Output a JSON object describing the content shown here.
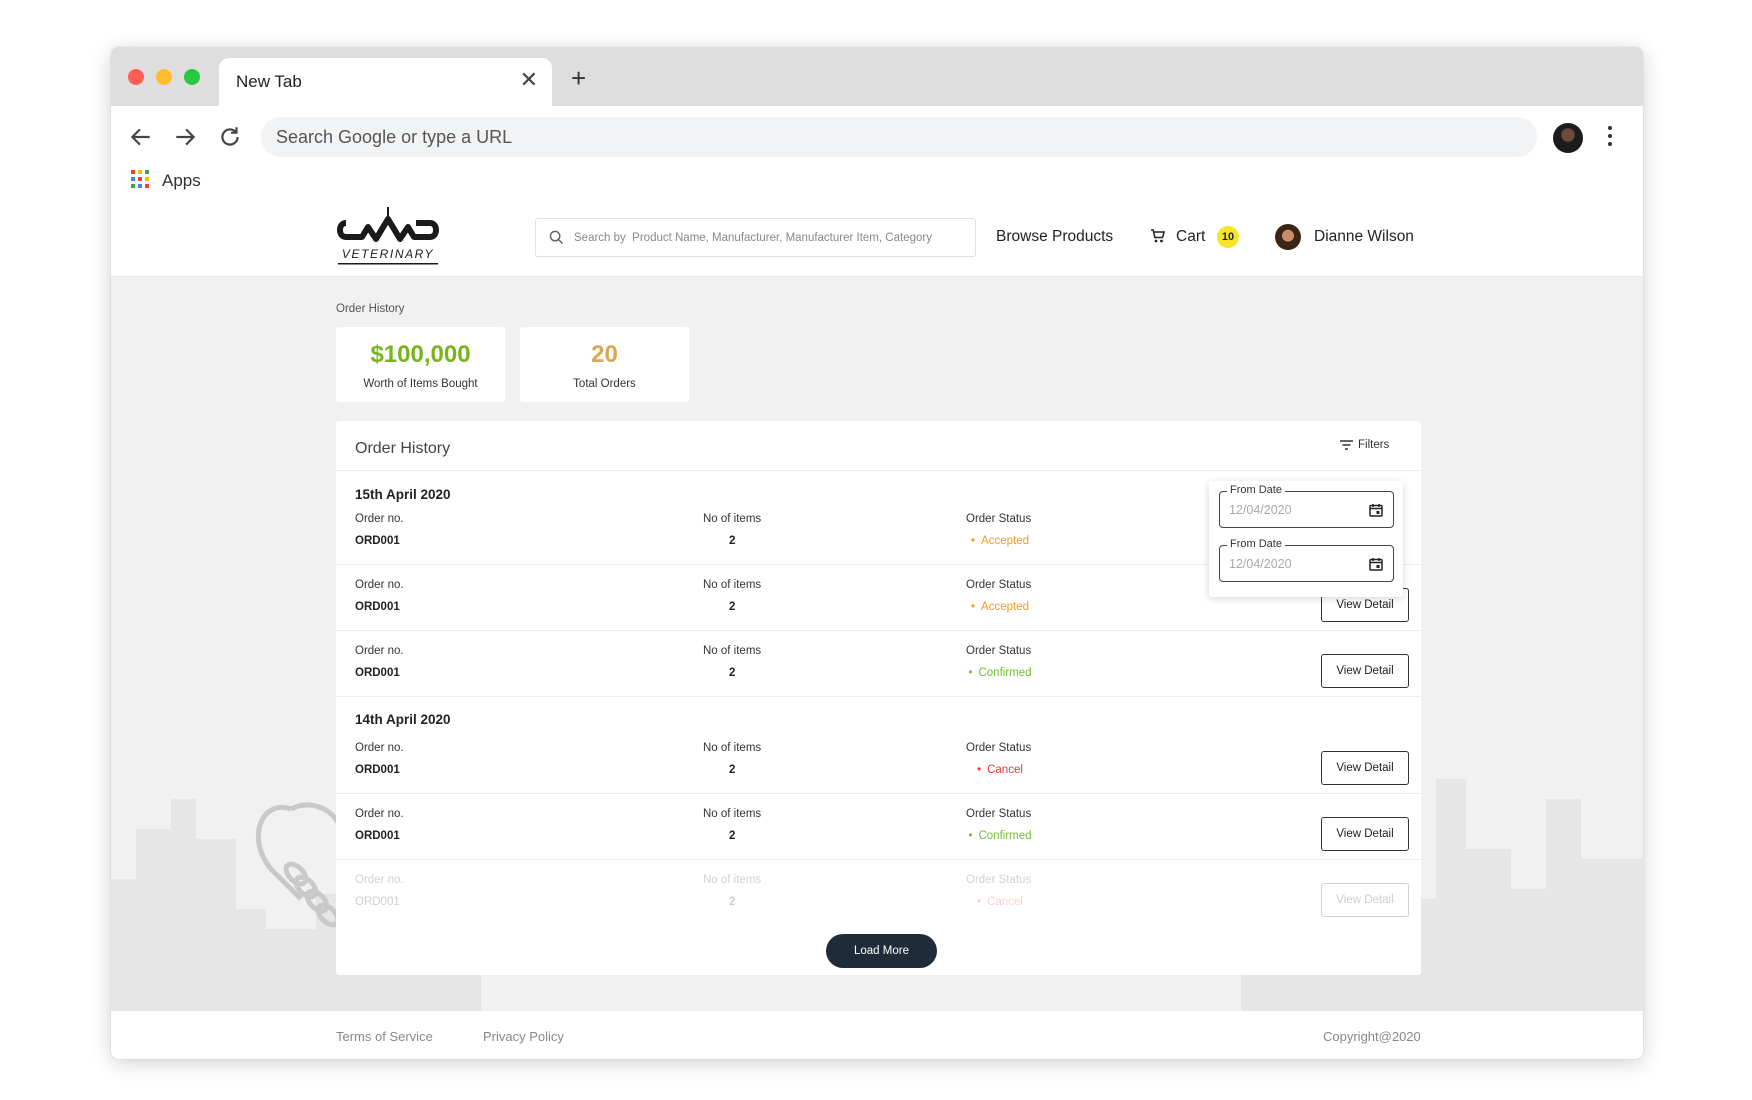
{
  "browser": {
    "tab_title": "New Tab",
    "address_placeholder": "Search Google or type a URL",
    "bookmarks": {
      "apps_label": "Apps"
    }
  },
  "header": {
    "search_placeholder": "Search by  Product Name, Manufacturer, Manufacturer Item, Category",
    "browse_label": "Browse Products",
    "cart_label": "Cart",
    "cart_count": "10",
    "user_name": "Dianne Wilson"
  },
  "breadcrumb": "Order History",
  "stats": [
    {
      "value": "$100,000",
      "label": "Worth of Items Bought",
      "color": "#79b41f"
    },
    {
      "value": "20",
      "label": "Total Orders",
      "color": "#d7a84f"
    }
  ],
  "panel": {
    "title": "Order History",
    "filters_label": "Filters",
    "columns": {
      "order_no": "Order no.",
      "items": "No of items",
      "status": "Order Status"
    },
    "view_label": "View Detail",
    "load_more_label": "Load More",
    "groups": [
      {
        "date": "15th April 2020",
        "orders": [
          {
            "order_no": "ORD001",
            "items": "2",
            "status": "Accepted"
          },
          {
            "order_no": "ORD001",
            "items": "2",
            "status": "Accepted"
          },
          {
            "order_no": "ORD001",
            "items": "2",
            "status": "Confirmed"
          }
        ]
      },
      {
        "date": "14th April 2020",
        "orders": [
          {
            "order_no": "ORD001",
            "items": "2",
            "status": "Cancel"
          },
          {
            "order_no": "ORD001",
            "items": "2",
            "status": "Confirmed"
          },
          {
            "order_no": "ORD001",
            "items": "2",
            "status": "Cancel"
          }
        ]
      }
    ]
  },
  "filter_popover": {
    "fields": [
      {
        "label": "From Date",
        "value": "12/04/2020"
      },
      {
        "label": "From Date",
        "value": "12/04/2020"
      }
    ]
  },
  "footer": {
    "terms": "Terms of Service",
    "privacy": "Privacy Policy",
    "copyright": "Copyright@2020"
  },
  "colors": {
    "accepted": "#f29a1b",
    "confirmed": "#6fbf36",
    "cancel": "#e5383b",
    "cart_badge": "#f5e52a",
    "load_more_bg": "#1f2b38"
  }
}
